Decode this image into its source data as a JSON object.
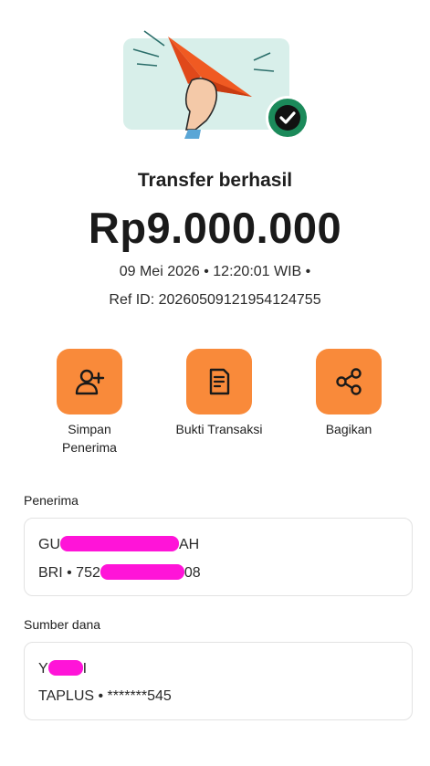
{
  "header": {
    "title": "Transfer berhasil",
    "amount": "Rp9.000.000",
    "datetime": "09 Mei 2026 • 12:20:01 WIB •",
    "ref_id": "Ref ID: 20260509121954124755"
  },
  "actions": [
    {
      "label": "Simpan Penerima",
      "icon": "add-person-icon"
    },
    {
      "label": "Bukti Transaksi",
      "icon": "receipt-icon"
    },
    {
      "label": "Bagikan",
      "icon": "share-icon"
    }
  ],
  "recipient": {
    "section_label": "Penerima",
    "name_prefix": "GU",
    "name_suffix": "AH",
    "bank_prefix": "BRI • 752",
    "bank_suffix": "08"
  },
  "source": {
    "section_label": "Sumber dana",
    "name_prefix": "Y",
    "name_suffix": "I",
    "account": "TAPLUS • *******545"
  },
  "colors": {
    "accent": "#f98a3a",
    "success": "#1b8a5a",
    "mask": "#ff14d8",
    "illustration_bg": "#d8efea"
  }
}
